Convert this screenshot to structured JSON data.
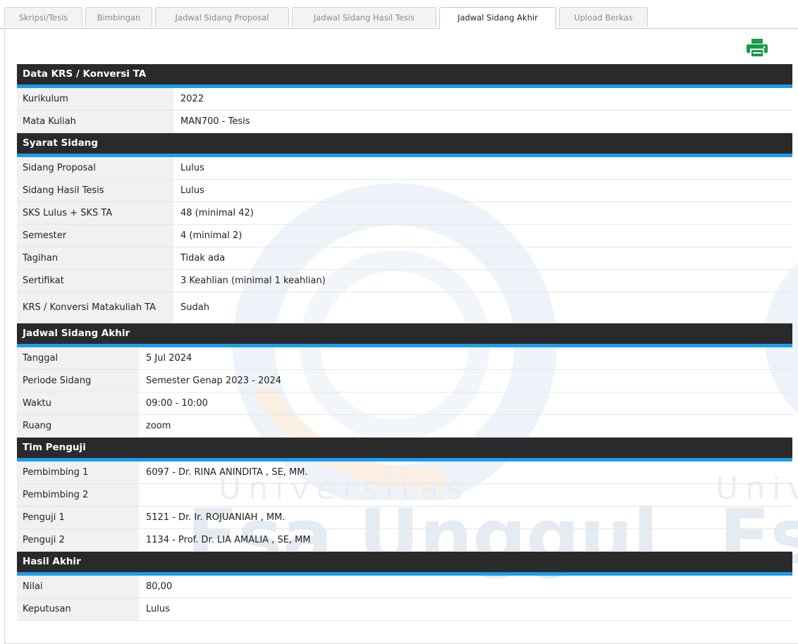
{
  "tabs": [
    {
      "label": "Skripsi/Tesis"
    },
    {
      "label": "Bimbingan"
    },
    {
      "label": "Jadwal Sidang Proposal"
    },
    {
      "label": "Jadwal Sidang Hasil Tesis"
    },
    {
      "label": "Jadwal Sidang Akhir",
      "active": true
    },
    {
      "label": "Upload Berkas"
    }
  ],
  "watermark": {
    "line1": "Universitas",
    "line2": "Esa Unggul",
    "line1_right": "Univ",
    "line2_right": "Es"
  },
  "print_icon": "printer-icon",
  "colors": {
    "accent": "#1e9cec",
    "header_bg": "#2a2a2a",
    "print_icon": "#1a9a4a"
  },
  "sections": {
    "krs": {
      "title": "Data KRS / Konversi TA",
      "rows": [
        {
          "label": "Kurikulum",
          "value": "2022"
        },
        {
          "label": "Mata Kuliah",
          "value": "MAN700 - Tesis"
        }
      ]
    },
    "syarat": {
      "title": "Syarat Sidang",
      "rows": [
        {
          "label": "Sidang Proposal",
          "value": "Lulus"
        },
        {
          "label": "Sidang Hasil Tesis",
          "value": "Lulus"
        },
        {
          "label": "SKS Lulus + SKS TA",
          "value": "48 (minimal 42)"
        },
        {
          "label": "Semester",
          "value": "4 (minimal 2)"
        },
        {
          "label": "Tagihan",
          "value": "Tidak ada"
        },
        {
          "label": "Sertifikat",
          "value": "3 Keahlian (minimal 1 keahlian)"
        },
        {
          "label": "KRS / Konversi Matakuliah TA",
          "value": "Sudah"
        }
      ]
    },
    "jadwal": {
      "title": "Jadwal Sidang Akhir",
      "rows": [
        {
          "label": "Tanggal",
          "value": "5 Jul 2024"
        },
        {
          "label": "Periode Sidang",
          "value": "Semester Genap 2023 - 2024"
        },
        {
          "label": "Waktu",
          "value": "09:00 - 10:00"
        },
        {
          "label": "Ruang",
          "value": "zoom"
        }
      ]
    },
    "tim": {
      "title": "Tim Penguji",
      "rows": [
        {
          "label": "Pembimbing 1",
          "value": "6097 - Dr. RINA ANINDITA , SE, MM."
        },
        {
          "label": "Pembimbing 2",
          "value": ""
        },
        {
          "label": "Penguji 1",
          "value": "5121 - Dr. Ir. ROJUANIAH , MM."
        },
        {
          "label": "Penguji 2",
          "value": "1134 - Prof. Dr. LIA AMALIA , SE, MM"
        }
      ]
    },
    "hasil": {
      "title": "Hasil Akhir",
      "rows": [
        {
          "label": "Nilai",
          "value": "80,00"
        },
        {
          "label": "Keputusan",
          "value": "Lulus"
        }
      ]
    }
  }
}
